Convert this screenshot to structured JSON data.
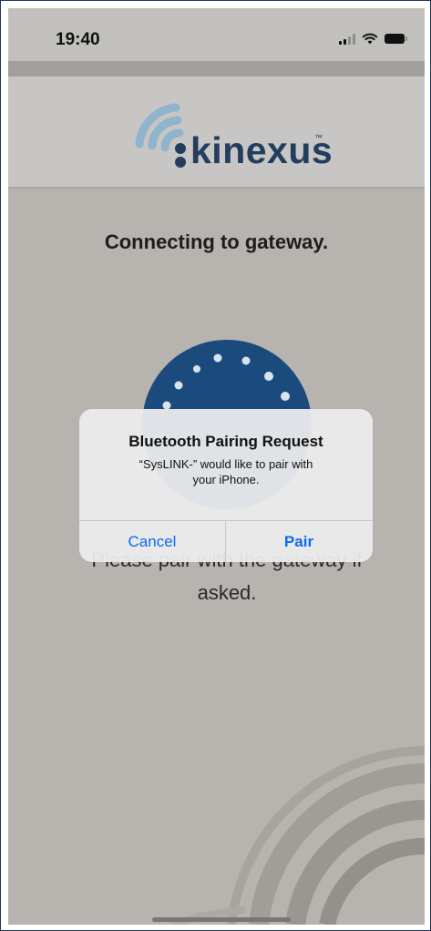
{
  "status_bar": {
    "time": "19:40",
    "icons": [
      "cellular-signal-icon",
      "wifi-icon",
      "battery-icon"
    ]
  },
  "header": {
    "brand": "kinexus",
    "trademark": "™"
  },
  "main": {
    "title": "Connecting to gateway.",
    "instructions_line1": "Please pair with the gateway if",
    "instructions_line2": "asked."
  },
  "alert": {
    "title": "Bluetooth Pairing Request",
    "message_line1": "“SysLINK-” would like to pair with",
    "message_line2": "your iPhone.",
    "cancel_label": "Cancel",
    "pair_label": "Pair"
  },
  "colors": {
    "brand_navy": "#233d5e",
    "brand_light_blue": "#8fb4cc",
    "spinner_blue": "#1b4a7d",
    "ios_link_blue": "#0a6cf0"
  }
}
